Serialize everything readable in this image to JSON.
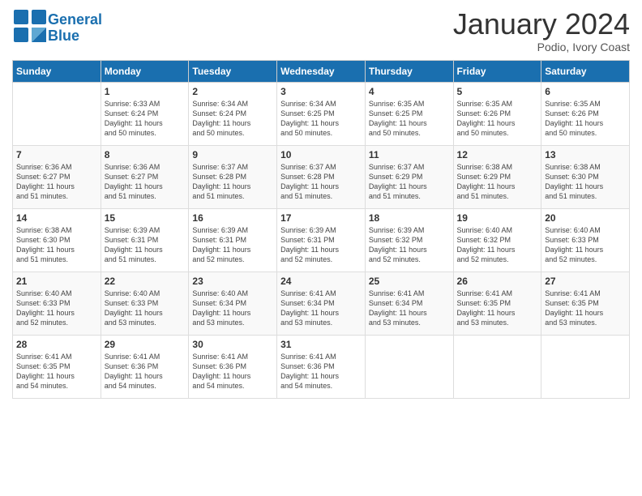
{
  "logo": {
    "line1": "General",
    "line2": "Blue"
  },
  "title": "January 2024",
  "subtitle": "Podio, Ivory Coast",
  "days_header": [
    "Sunday",
    "Monday",
    "Tuesday",
    "Wednesday",
    "Thursday",
    "Friday",
    "Saturday"
  ],
  "weeks": [
    [
      {
        "num": "",
        "sunrise": "",
        "sunset": "",
        "daylight": ""
      },
      {
        "num": "1",
        "sunrise": "Sunrise: 6:33 AM",
        "sunset": "Sunset: 6:24 PM",
        "daylight": "Daylight: 11 hours and 50 minutes."
      },
      {
        "num": "2",
        "sunrise": "Sunrise: 6:34 AM",
        "sunset": "Sunset: 6:24 PM",
        "daylight": "Daylight: 11 hours and 50 minutes."
      },
      {
        "num": "3",
        "sunrise": "Sunrise: 6:34 AM",
        "sunset": "Sunset: 6:25 PM",
        "daylight": "Daylight: 11 hours and 50 minutes."
      },
      {
        "num": "4",
        "sunrise": "Sunrise: 6:35 AM",
        "sunset": "Sunset: 6:25 PM",
        "daylight": "Daylight: 11 hours and 50 minutes."
      },
      {
        "num": "5",
        "sunrise": "Sunrise: 6:35 AM",
        "sunset": "Sunset: 6:26 PM",
        "daylight": "Daylight: 11 hours and 50 minutes."
      },
      {
        "num": "6",
        "sunrise": "Sunrise: 6:35 AM",
        "sunset": "Sunset: 6:26 PM",
        "daylight": "Daylight: 11 hours and 50 minutes."
      }
    ],
    [
      {
        "num": "7",
        "sunrise": "Sunrise: 6:36 AM",
        "sunset": "Sunset: 6:27 PM",
        "daylight": "Daylight: 11 hours and 51 minutes."
      },
      {
        "num": "8",
        "sunrise": "Sunrise: 6:36 AM",
        "sunset": "Sunset: 6:27 PM",
        "daylight": "Daylight: 11 hours and 51 minutes."
      },
      {
        "num": "9",
        "sunrise": "Sunrise: 6:37 AM",
        "sunset": "Sunset: 6:28 PM",
        "daylight": "Daylight: 11 hours and 51 minutes."
      },
      {
        "num": "10",
        "sunrise": "Sunrise: 6:37 AM",
        "sunset": "Sunset: 6:28 PM",
        "daylight": "Daylight: 11 hours and 51 minutes."
      },
      {
        "num": "11",
        "sunrise": "Sunrise: 6:37 AM",
        "sunset": "Sunset: 6:29 PM",
        "daylight": "Daylight: 11 hours and 51 minutes."
      },
      {
        "num": "12",
        "sunrise": "Sunrise: 6:38 AM",
        "sunset": "Sunset: 6:29 PM",
        "daylight": "Daylight: 11 hours and 51 minutes."
      },
      {
        "num": "13",
        "sunrise": "Sunrise: 6:38 AM",
        "sunset": "Sunset: 6:30 PM",
        "daylight": "Daylight: 11 hours and 51 minutes."
      }
    ],
    [
      {
        "num": "14",
        "sunrise": "Sunrise: 6:38 AM",
        "sunset": "Sunset: 6:30 PM",
        "daylight": "Daylight: 11 hours and 51 minutes."
      },
      {
        "num": "15",
        "sunrise": "Sunrise: 6:39 AM",
        "sunset": "Sunset: 6:31 PM",
        "daylight": "Daylight: 11 hours and 51 minutes."
      },
      {
        "num": "16",
        "sunrise": "Sunrise: 6:39 AM",
        "sunset": "Sunset: 6:31 PM",
        "daylight": "Daylight: 11 hours and 52 minutes."
      },
      {
        "num": "17",
        "sunrise": "Sunrise: 6:39 AM",
        "sunset": "Sunset: 6:31 PM",
        "daylight": "Daylight: 11 hours and 52 minutes."
      },
      {
        "num": "18",
        "sunrise": "Sunrise: 6:39 AM",
        "sunset": "Sunset: 6:32 PM",
        "daylight": "Daylight: 11 hours and 52 minutes."
      },
      {
        "num": "19",
        "sunrise": "Sunrise: 6:40 AM",
        "sunset": "Sunset: 6:32 PM",
        "daylight": "Daylight: 11 hours and 52 minutes."
      },
      {
        "num": "20",
        "sunrise": "Sunrise: 6:40 AM",
        "sunset": "Sunset: 6:33 PM",
        "daylight": "Daylight: 11 hours and 52 minutes."
      }
    ],
    [
      {
        "num": "21",
        "sunrise": "Sunrise: 6:40 AM",
        "sunset": "Sunset: 6:33 PM",
        "daylight": "Daylight: 11 hours and 52 minutes."
      },
      {
        "num": "22",
        "sunrise": "Sunrise: 6:40 AM",
        "sunset": "Sunset: 6:33 PM",
        "daylight": "Daylight: 11 hours and 53 minutes."
      },
      {
        "num": "23",
        "sunrise": "Sunrise: 6:40 AM",
        "sunset": "Sunset: 6:34 PM",
        "daylight": "Daylight: 11 hours and 53 minutes."
      },
      {
        "num": "24",
        "sunrise": "Sunrise: 6:41 AM",
        "sunset": "Sunset: 6:34 PM",
        "daylight": "Daylight: 11 hours and 53 minutes."
      },
      {
        "num": "25",
        "sunrise": "Sunrise: 6:41 AM",
        "sunset": "Sunset: 6:34 PM",
        "daylight": "Daylight: 11 hours and 53 minutes."
      },
      {
        "num": "26",
        "sunrise": "Sunrise: 6:41 AM",
        "sunset": "Sunset: 6:35 PM",
        "daylight": "Daylight: 11 hours and 53 minutes."
      },
      {
        "num": "27",
        "sunrise": "Sunrise: 6:41 AM",
        "sunset": "Sunset: 6:35 PM",
        "daylight": "Daylight: 11 hours and 53 minutes."
      }
    ],
    [
      {
        "num": "28",
        "sunrise": "Sunrise: 6:41 AM",
        "sunset": "Sunset: 6:35 PM",
        "daylight": "Daylight: 11 hours and 54 minutes."
      },
      {
        "num": "29",
        "sunrise": "Sunrise: 6:41 AM",
        "sunset": "Sunset: 6:36 PM",
        "daylight": "Daylight: 11 hours and 54 minutes."
      },
      {
        "num": "30",
        "sunrise": "Sunrise: 6:41 AM",
        "sunset": "Sunset: 6:36 PM",
        "daylight": "Daylight: 11 hours and 54 minutes."
      },
      {
        "num": "31",
        "sunrise": "Sunrise: 6:41 AM",
        "sunset": "Sunset: 6:36 PM",
        "daylight": "Daylight: 11 hours and 54 minutes."
      },
      {
        "num": "",
        "sunrise": "",
        "sunset": "",
        "daylight": ""
      },
      {
        "num": "",
        "sunrise": "",
        "sunset": "",
        "daylight": ""
      },
      {
        "num": "",
        "sunrise": "",
        "sunset": "",
        "daylight": ""
      }
    ]
  ]
}
